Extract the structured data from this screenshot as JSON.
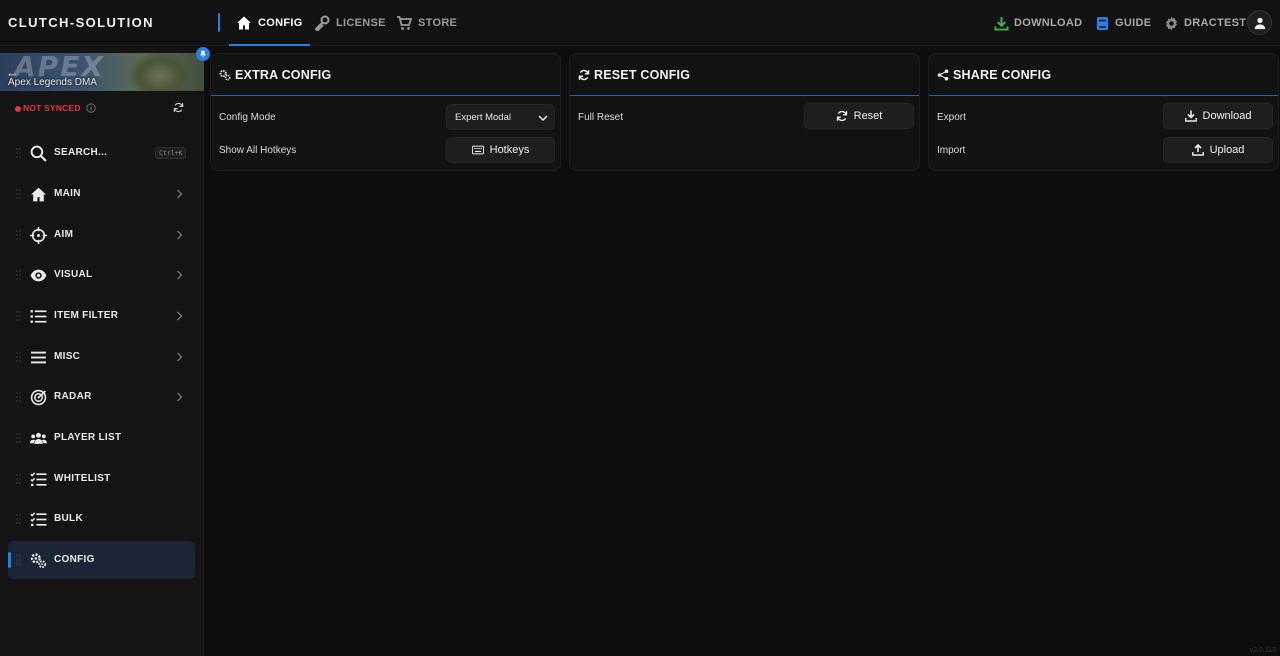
{
  "app": {
    "brand": "CLUTCH-SOLUTION",
    "accent_color": "#2a7de1",
    "version": "v3.0.113"
  },
  "top_nav": {
    "tabs": [
      {
        "label": "CONFIG",
        "icon": "home-icon",
        "active": true
      },
      {
        "label": "LICENSE",
        "icon": "key-icon",
        "active": false
      },
      {
        "label": "STORE",
        "icon": "cart-icon",
        "active": false
      }
    ],
    "right": {
      "download_label": "DOWNLOAD",
      "guide_label": "GUIDE",
      "user_label": "DRACTEST"
    }
  },
  "sidebar": {
    "game_title": "Apex Legends DMA",
    "banner_logo": "APEX",
    "sync_status": "NOT SYNCED",
    "search_shortcut": "Ctrl+K",
    "items": [
      {
        "label": "SEARCH...",
        "icon": "search-icon",
        "has_chevron": false
      },
      {
        "label": "MAIN",
        "icon": "home-icon",
        "has_chevron": true
      },
      {
        "label": "AIM",
        "icon": "crosshair-icon",
        "has_chevron": true
      },
      {
        "label": "VISUAL",
        "icon": "eye-icon",
        "has_chevron": true
      },
      {
        "label": "ITEM FILTER",
        "icon": "list-icon",
        "has_chevron": true
      },
      {
        "label": "MISC",
        "icon": "menu-icon",
        "has_chevron": true
      },
      {
        "label": "RADAR",
        "icon": "radar-icon",
        "has_chevron": true
      },
      {
        "label": "PLAYER LIST",
        "icon": "users-icon",
        "has_chevron": false
      },
      {
        "label": "WHITELIST",
        "icon": "checklist-icon",
        "has_chevron": false
      },
      {
        "label": "BULK",
        "icon": "checklist-icon",
        "has_chevron": false
      },
      {
        "label": "CONFIG",
        "icon": "gears-icon",
        "has_chevron": false,
        "active": true
      }
    ]
  },
  "cards": {
    "extra": {
      "title": "EXTRA CONFIG",
      "config_mode_label": "Config Mode",
      "config_mode_value": "Expert Modal",
      "show_hotkeys_label": "Show All Hotkeys",
      "hotkeys_button": "Hotkeys"
    },
    "reset": {
      "title": "RESET CONFIG",
      "full_reset_label": "Full Reset",
      "reset_button": "Reset"
    },
    "share": {
      "title": "SHARE CONFIG",
      "export_label": "Export",
      "download_button": "Download",
      "import_label": "Import",
      "upload_button": "Upload"
    }
  }
}
